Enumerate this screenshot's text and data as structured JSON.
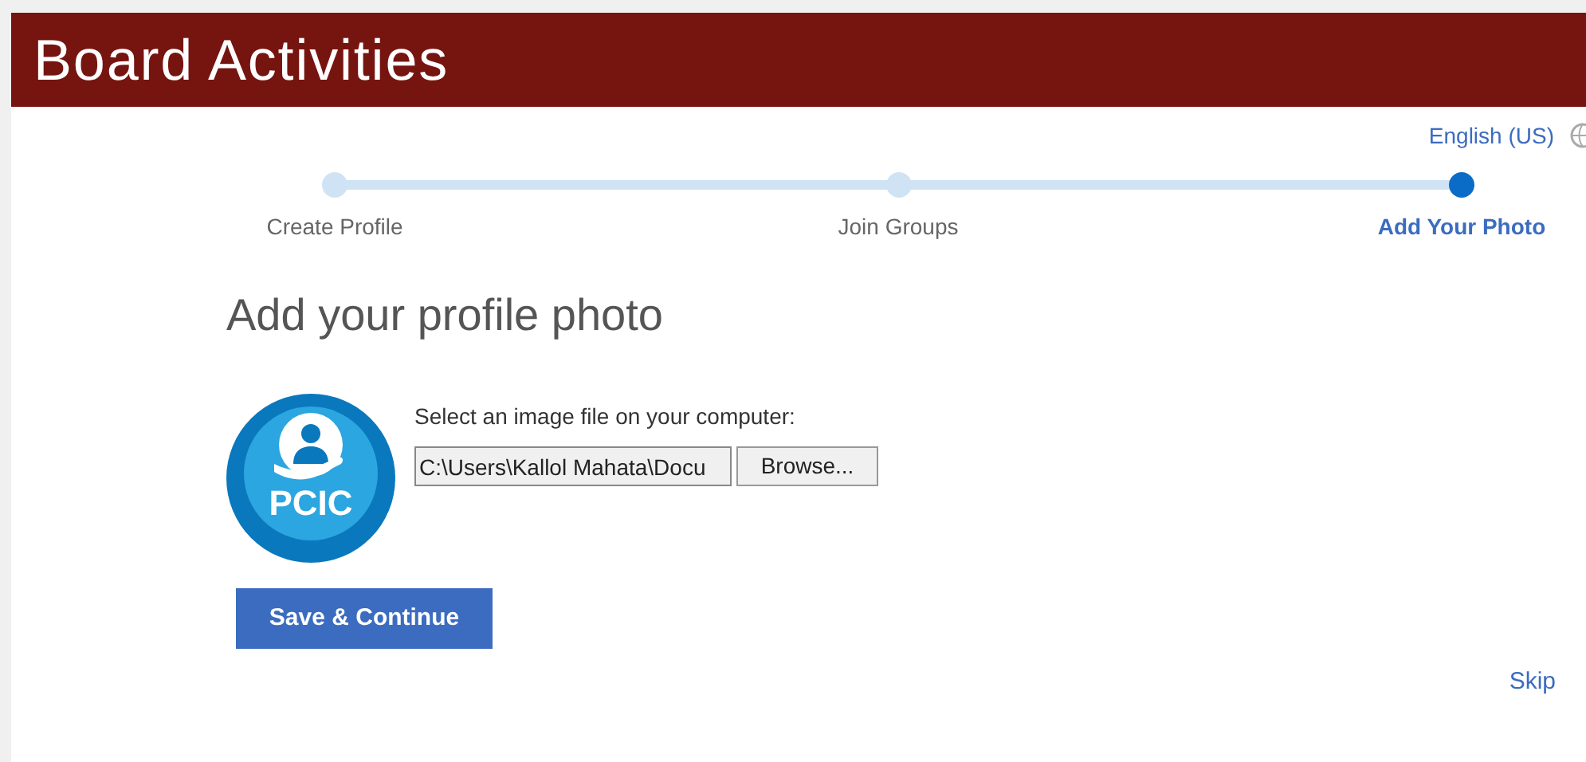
{
  "header": {
    "title": "Board Activities"
  },
  "language": {
    "label": "English (US)"
  },
  "steps": [
    {
      "label": "Create Profile",
      "selected": false
    },
    {
      "label": "Join Groups",
      "selected": false
    },
    {
      "label": "Add Your Photo",
      "selected": true
    }
  ],
  "heading": "Add your profile photo",
  "logo": {
    "text": "PCIC"
  },
  "file_prompt": "Select an image file on your computer:",
  "file_field": {
    "value": "C:\\Users\\Kallol Mahata\\Docu"
  },
  "browse_button": "Browse...",
  "save_button": "Save & Continue",
  "skip_link": "Skip"
}
